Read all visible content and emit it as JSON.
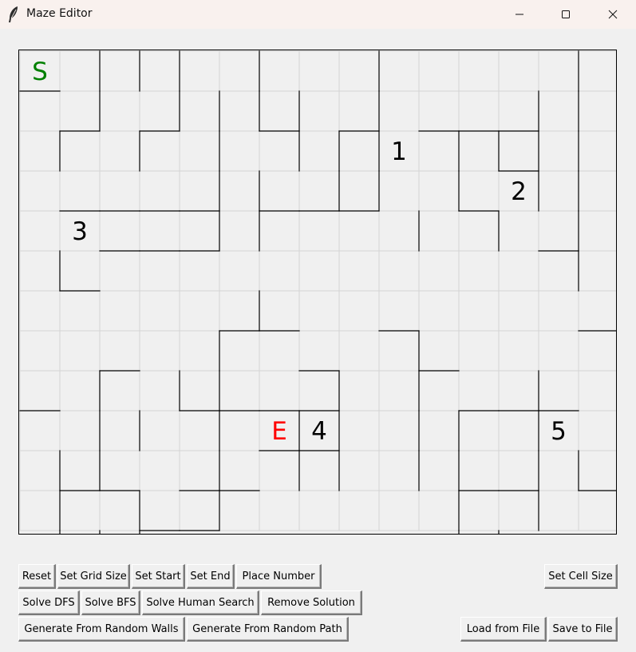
{
  "window": {
    "title": "Maze Editor"
  },
  "controls": {
    "minimize": "minimize-icon",
    "maximize": "maximize-icon",
    "close": "close-icon"
  },
  "maze": {
    "rows": 12,
    "cols": 15,
    "start": {
      "label": "S",
      "row": 0,
      "col": 0,
      "color": "#008000"
    },
    "end": {
      "label": "E",
      "row": 9,
      "col": 6,
      "color": "#ff0000"
    },
    "numbers": [
      {
        "label": "1",
        "row": 2,
        "col": 9
      },
      {
        "label": "2",
        "row": 3,
        "col": 12
      },
      {
        "label": "3",
        "row": 4,
        "col": 1
      },
      {
        "label": "4",
        "row": 9,
        "col": 7
      },
      {
        "label": "5",
        "row": 9,
        "col": 13
      }
    ],
    "h_walls": [
      "000000000000000",
      "100000000000000",
      "010100101011100",
      "000000000000100",
      "011110111001000",
      "001110000000010",
      "010000000000000",
      "000001100100001",
      "001000010010000",
      "100011110001110",
      "000000110000000",
      "011011000001101",
      "000110000000000",
      "000000000000000"
    ],
    "v_walls": [
      "0011101001000010",
      "0010111101000110",
      "0101010111011110",
      "0000011011010110",
      "0000011000101010",
      "0100000000000010",
      "0000001000000000",
      "0000010000100000",
      "0010110010100100",
      "0011010110110100",
      "0110010110110110",
      "0101010000010100",
      "0111000000011000"
    ]
  },
  "buttons": {
    "reset": "Reset",
    "set_grid_size": "Set Grid Size",
    "set_start": "Set Start",
    "set_end": "Set End",
    "place_number": "Place Number",
    "set_cell_size": "Set Cell Size",
    "solve_dfs": "Solve DFS",
    "solve_bfs": "Solve BFS",
    "solve_human": "Solve Human Search",
    "remove_solution": "Remove Solution",
    "gen_random_walls": "Generate From Random Walls",
    "gen_random_path": "Generate From Random Path",
    "load_file": "Load from File",
    "save_file": "Save to File"
  }
}
